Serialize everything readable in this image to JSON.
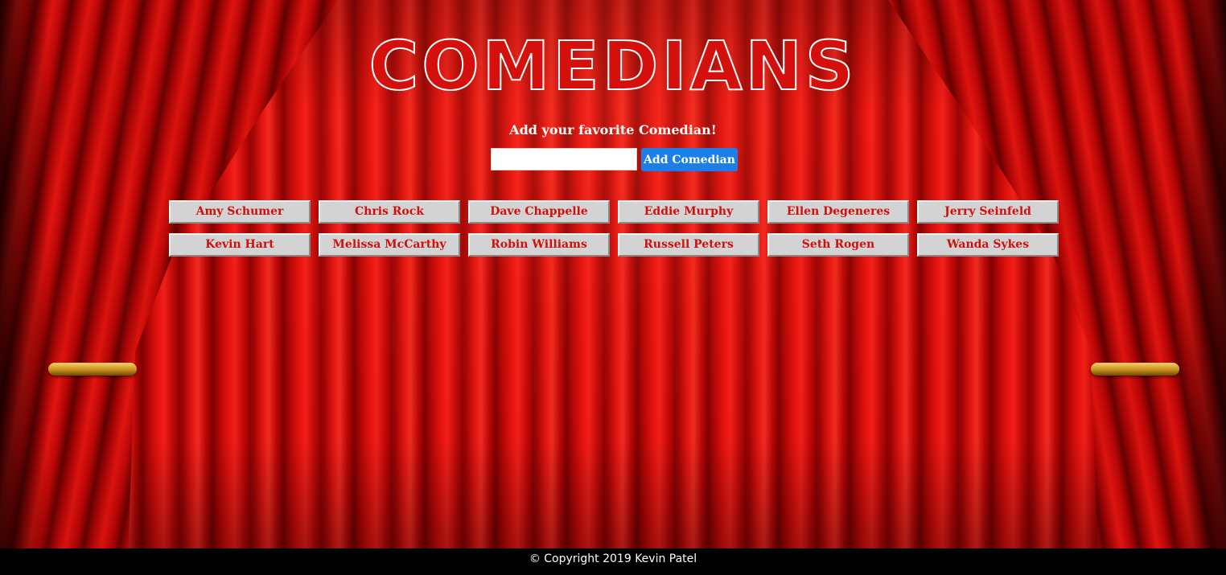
{
  "page": {
    "title": "COMEDIANS",
    "subtitle": "Add your favorite Comedian!"
  },
  "form": {
    "input_value": "",
    "input_placeholder": "",
    "button_label": "Add Comedian",
    "button_color": "#1a7fe8"
  },
  "comedians": [
    {
      "label": "Amy Schumer"
    },
    {
      "label": "Chris Rock"
    },
    {
      "label": "Dave Chappelle"
    },
    {
      "label": "Eddie Murphy"
    },
    {
      "label": "Ellen Degeneres"
    },
    {
      "label": "Jerry Seinfeld"
    },
    {
      "label": "Kevin Hart"
    },
    {
      "label": "Melissa McCarthy"
    },
    {
      "label": "Robin Williams"
    },
    {
      "label": "Russell Peters"
    },
    {
      "label": "Seth Rogen"
    },
    {
      "label": "Wanda Sykes"
    }
  ],
  "footer": {
    "text": "© Copyright 2019 Kevin Patel"
  },
  "colors": {
    "curtain": "#e3120e",
    "comedian_text": "#d0100c",
    "comedian_button_bg": "#d3d3d3",
    "footer_bg": "#000000"
  }
}
